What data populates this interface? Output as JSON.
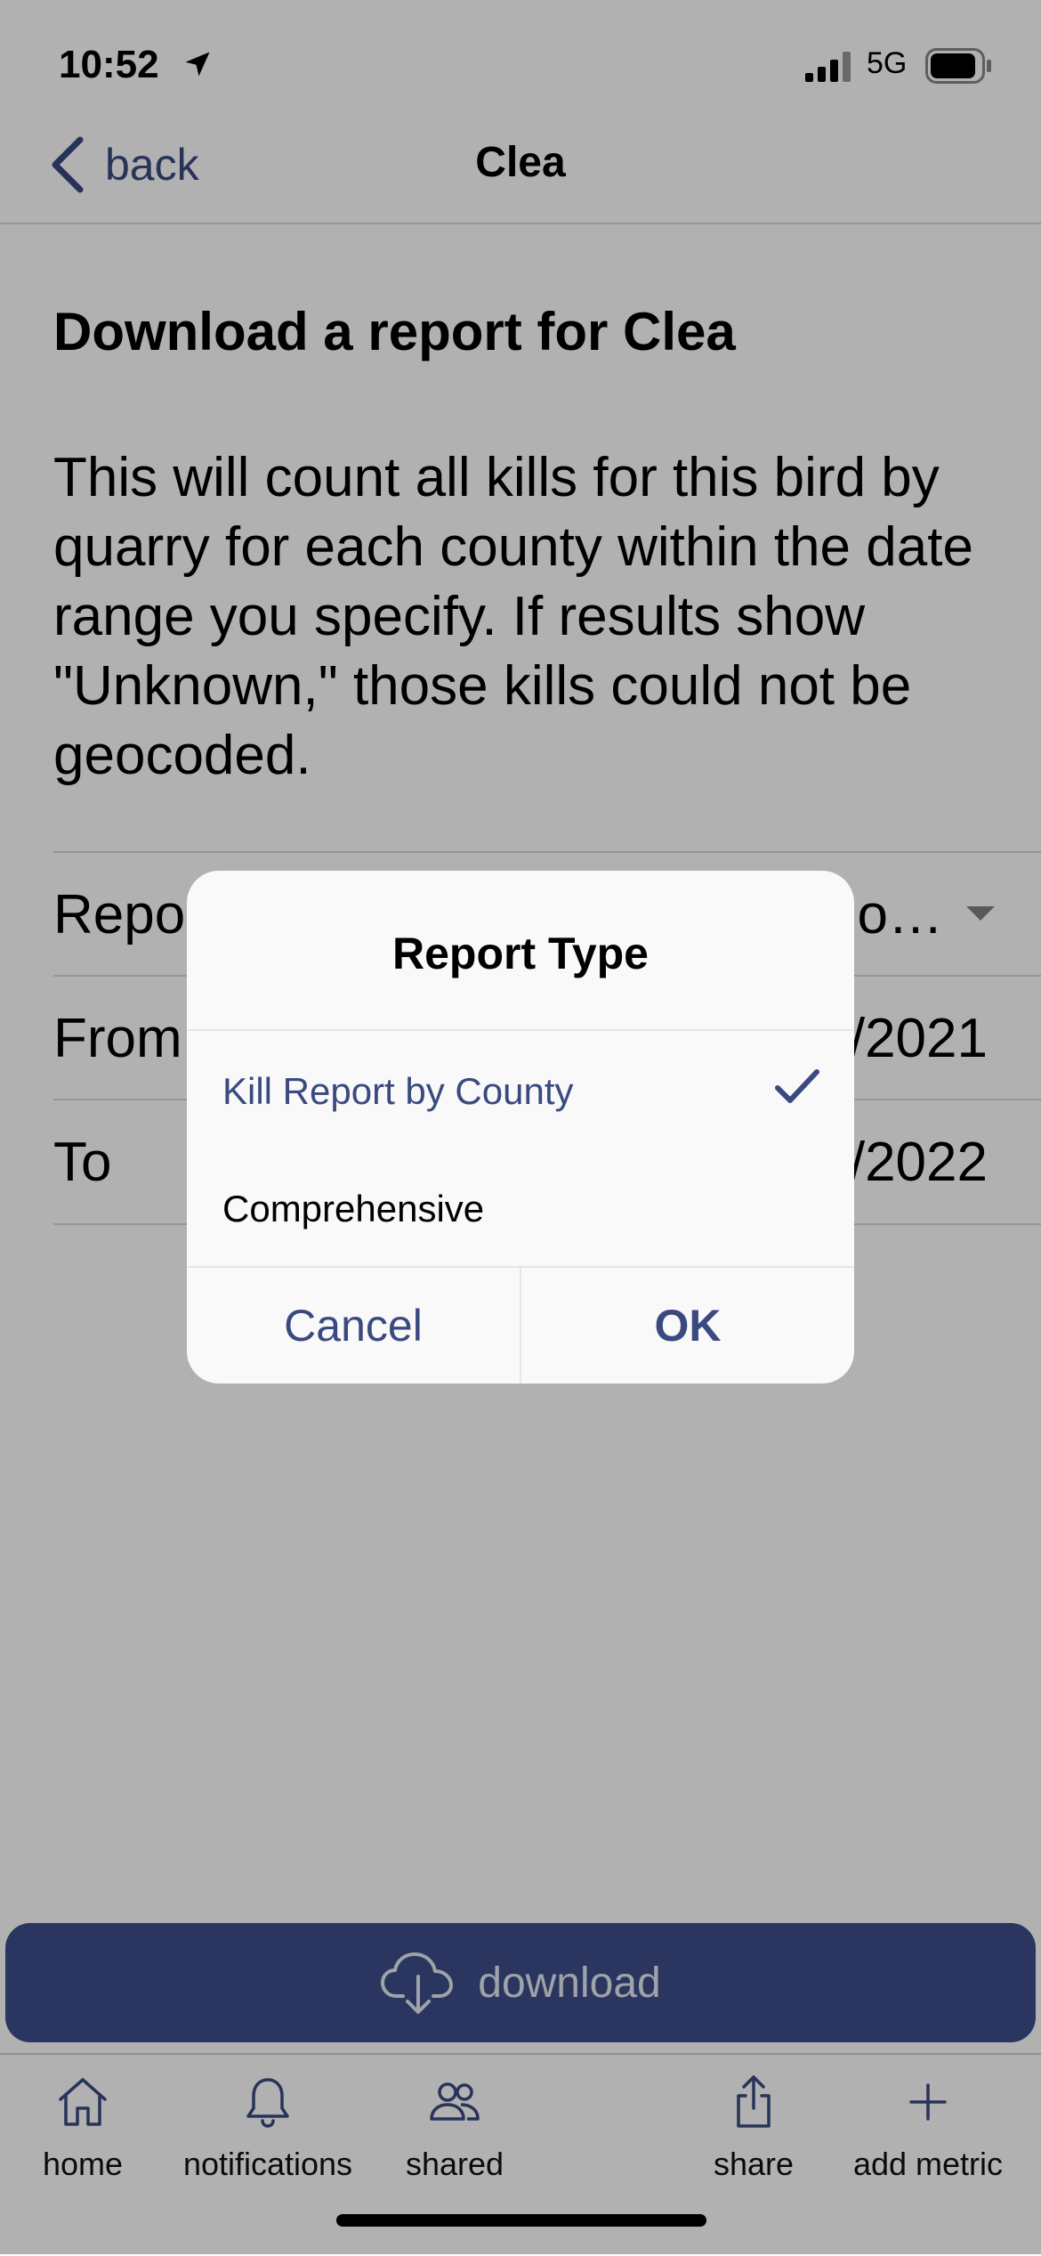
{
  "status_bar": {
    "time": "10:52",
    "network": "5G",
    "icons": [
      "location-arrow-icon",
      "signal-bars-icon",
      "battery-icon"
    ]
  },
  "nav": {
    "back_label": "back",
    "title": "Clea"
  },
  "content": {
    "heading": "Download a report for Clea",
    "description": "This will count all kills for this bird by quarry for each county within the date range you specify. If results show \"Unknown,\" those kills could not be geocoded.",
    "rows": [
      {
        "label": "Repo",
        "value": "o…",
        "has_caret": true
      },
      {
        "label": "From",
        "value": "/2021"
      },
      {
        "label": "To",
        "value": "/2022"
      }
    ]
  },
  "download": {
    "label": "download",
    "icon": "cloud-download-icon"
  },
  "tabs": [
    {
      "label": "home",
      "icon": "house-icon"
    },
    {
      "label": "notifications",
      "icon": "bell-icon"
    },
    {
      "label": "shared",
      "icon": "people-icon"
    },
    {
      "label": "share",
      "icon": "share-icon"
    },
    {
      "label": "add metric",
      "icon": "plus-icon"
    }
  ],
  "dialog": {
    "title": "Report Type",
    "options": [
      {
        "label": "Kill Report by County",
        "selected": true
      },
      {
        "label": "Comprehensive",
        "selected": false
      }
    ],
    "cancel_label": "Cancel",
    "ok_label": "OK"
  },
  "colors": {
    "accent": "#3a4a80",
    "download_bg": "#3d4f8a",
    "overlay": "rgba(0,0,0,0.305)"
  }
}
